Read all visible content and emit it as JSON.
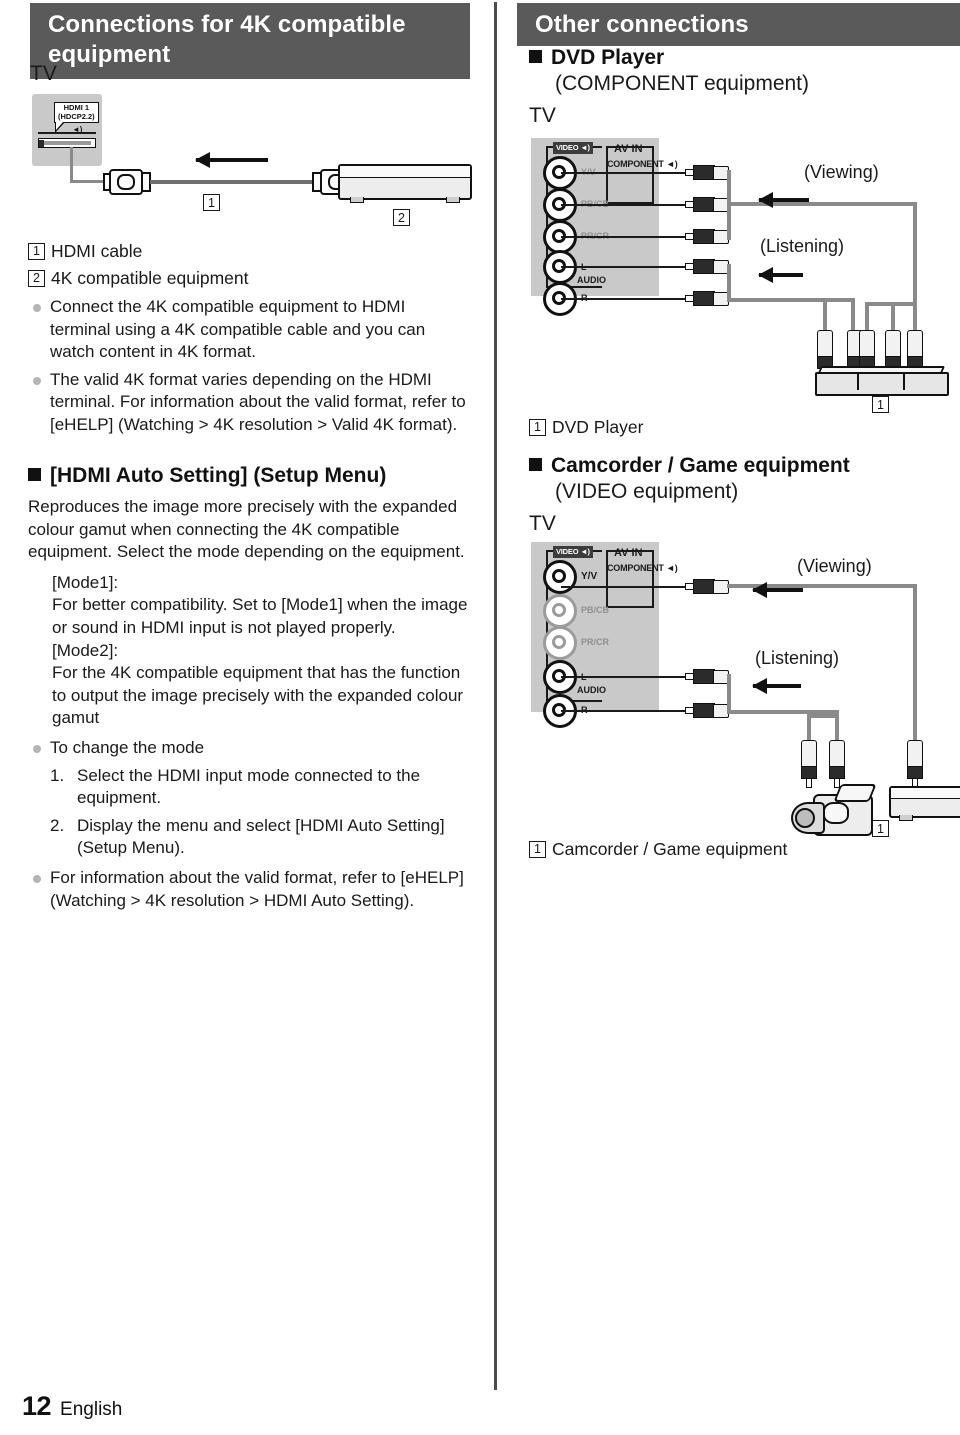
{
  "page": {
    "number": "12",
    "language": "English"
  },
  "left_column": {
    "header": "Connections for 4K compatible equipment",
    "diagram": {
      "tv_label": "TV",
      "hdmi_tag_line1": "HDMI 1",
      "hdmi_tag_line2": "(HDCP2.2)",
      "marker_cable": "1",
      "marker_equipment": "2"
    },
    "legend": [
      {
        "marker": "1",
        "text": "HDMI cable"
      },
      {
        "marker": "2",
        "text": "4K compatible equipment"
      }
    ],
    "bullets": [
      "Connect the 4K compatible equipment to HDMI terminal using a 4K compatible cable and you can watch content in 4K format.",
      "The valid 4K format varies depending on the HDMI terminal. For information about the valid format, refer to [eHELP] (Watching > 4K resolution > Valid 4K format)."
    ],
    "hdmi_auto_setting": {
      "heading": "[HDMI Auto Setting] (Setup Menu)",
      "intro": "Reproduces the image more precisely with the expanded colour gamut when connecting the 4K compatible equipment. Select the mode depending on the equipment.",
      "mode1_label": "[Mode1]:",
      "mode1_text": "For better compatibility. Set to [Mode1] when the image or sound in HDMI input is not played properly.",
      "mode2_label": "[Mode2]:",
      "mode2_text": "For the 4K compatible equipment that has the function to output the image precisely with the expanded colour gamut",
      "change_mode_bullet": "To change the mode",
      "steps": [
        {
          "number": "1.",
          "text": "Select the HDMI input mode connected to the equipment."
        },
        {
          "number": "2.",
          "text": "Display the menu and select [HDMI Auto Setting] (Setup Menu)."
        }
      ],
      "final_bullet": "For information about the valid format, refer to [eHELP] (Watching > 4K resolution > HDMI Auto Setting)."
    }
  },
  "right_column": {
    "header": "Other connections",
    "dvd_section": {
      "heading": "DVD Player",
      "subheading": "(COMPONENT equipment)",
      "tv_label": "TV",
      "terminal_labels": {
        "video": "VIDEO",
        "av_in": "AV IN",
        "component": "COMPONENT",
        "y_v": "Y/V",
        "pb_cb": "PB/CB",
        "pr_cr": "PR/CR",
        "audio": "AUDIO",
        "left": "L",
        "right": "R"
      },
      "viewing_label": "(Viewing)",
      "listening_label": "(Listening)",
      "marker": "1",
      "caption_marker": "1",
      "caption": "DVD Player"
    },
    "camcorder_section": {
      "heading": "Camcorder / Game equipment",
      "subheading": "(VIDEO equipment)",
      "tv_label": "TV",
      "terminal_labels": {
        "video": "VIDEO",
        "av_in": "AV IN",
        "component": "COMPONENT",
        "y_v": "Y/V",
        "pb_cb": "PB/CB",
        "pr_cr": "PR/CR",
        "audio": "AUDIO",
        "left": "L",
        "right": "R"
      },
      "viewing_label": "(Viewing)",
      "listening_label": "(Listening)",
      "marker": "1",
      "caption_marker": "1",
      "caption": "Camcorder / Game equipment"
    }
  },
  "colors": {
    "header_bar": "#5a5a5a",
    "panel_gray": "#c9c9c9",
    "wire_gray": "#8a8a8a",
    "bullet_gray": "#b5b5b5",
    "text": "#1a1a1a"
  }
}
